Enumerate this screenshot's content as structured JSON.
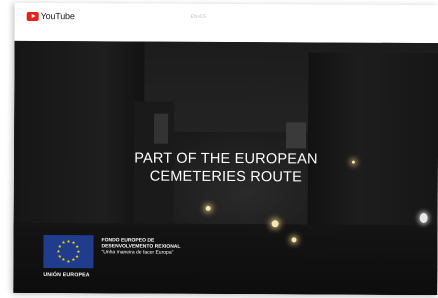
{
  "header": {
    "logo_text": "YouTube",
    "top_text": "EN·ES"
  },
  "video": {
    "title_line1": "PART OF THE EUROPEAN",
    "title_line2": "CEMETERIES ROUTE"
  },
  "eu": {
    "label": "UNIÓN EUROPEA",
    "fund_line1": "FONDO EUROPEO DE",
    "fund_line2": "DESENVOLVEMENTO REXIONAL",
    "motto": "\"Unha maneira de facer Europa\""
  },
  "colors": {
    "youtube_red": "#e62117",
    "eu_blue": "#1f3d8c",
    "eu_star": "#ffd400"
  },
  "icons": [
    "youtube-play-icon",
    "eu-flag-icon"
  ]
}
